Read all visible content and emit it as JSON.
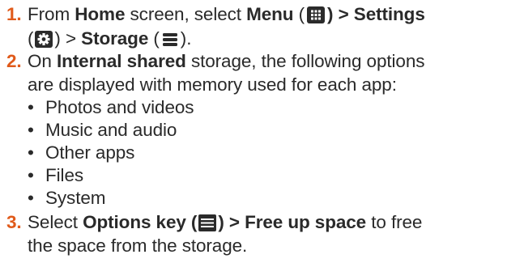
{
  "steps": [
    {
      "number": "1.",
      "text_from": "From",
      "home": "Home",
      "text_screen_select": "screen, select",
      "menu": "Menu",
      "paren_open": "(",
      "paren_close_gt": ") >",
      "settings": "Settings",
      "gt": ">",
      "storage": "Storage",
      "paren_close_end": ")."
    },
    {
      "number": "2.",
      "text_on": "On",
      "internal_shared": "Internal shared",
      "text_rest": "storage, the following options",
      "line2": "are displayed with memory used for each app:",
      "bullets": [
        "Photos and videos",
        "Music and audio",
        "Other apps",
        "Files",
        "System"
      ]
    },
    {
      "number": "3.",
      "text_select": "Select",
      "options_key": "Options key (",
      "free_up": ") > Free up space",
      "text_to_free": "to free",
      "line2": "the space from the storage."
    }
  ],
  "icons": {
    "menu": "grid-menu-icon",
    "settings": "gear-icon",
    "storage": "storage-lines-icon",
    "options": "options-key-icon"
  },
  "colors": {
    "step_number": "#e05a1a",
    "text": "#2a2a2a",
    "icon_fill": "#2b2b2b"
  }
}
